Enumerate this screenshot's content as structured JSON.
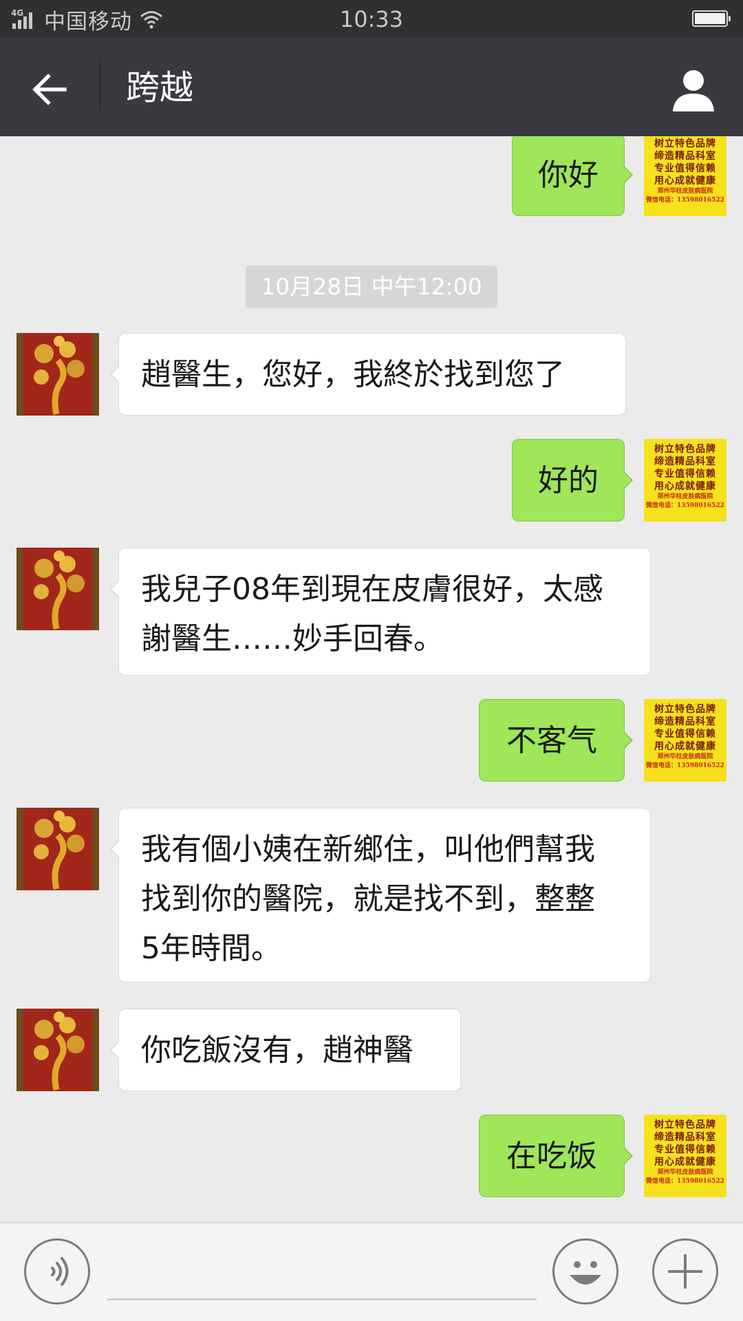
{
  "status_bar": {
    "network": "4G",
    "carrier": "中国移动",
    "time": "10:33",
    "battery_level": 1.0,
    "icons": [
      "signal-icon",
      "wifi-icon",
      "battery-icon"
    ]
  },
  "header": {
    "title": "跨越",
    "back_icon": "back-arrow-icon",
    "profile_icon": "person-icon"
  },
  "contact_avatar": {
    "description": "tree-image-avatar"
  },
  "my_avatar": {
    "lines": [
      "树立特色品牌",
      "缔造精品科室",
      "专业值得信赖",
      "用心成就健康"
    ],
    "small_lines": [
      "郑州华柱皮肤病医院",
      "微信电话：13598016522"
    ]
  },
  "timestamp": "10月28日 中午12:00",
  "messages": [
    {
      "side": "right",
      "text": "你好"
    },
    {
      "side": "left",
      "text": "趙醫生，您好，我終於找到您了"
    },
    {
      "side": "right",
      "text": "好的"
    },
    {
      "side": "left",
      "lines": [
        "我兒子08年到現在皮膚很好，太感",
        "謝醫生……妙手回春。"
      ]
    },
    {
      "side": "right",
      "text": "不客气"
    },
    {
      "side": "left",
      "lines": [
        "我有個小姨在新鄉住，叫他們幫我",
        "找到你的醫院，就是找不到，整整",
        "5年時間。"
      ]
    },
    {
      "side": "left",
      "text": "你吃飯沒有，趙神醫"
    },
    {
      "side": "right",
      "text": "在吃饭"
    }
  ],
  "input_bar": {
    "placeholder": "",
    "icons": [
      "voice-icon",
      "emoji-icon",
      "plus-icon"
    ]
  },
  "colors": {
    "status_bar": "#2f3032",
    "nav_bar": "#393a3f",
    "chat_bg": "#ebebeb",
    "sent_bubble": "#9fe658",
    "received_bubble": "#ffffff",
    "timestamp_bg": "#d6d6d6"
  }
}
